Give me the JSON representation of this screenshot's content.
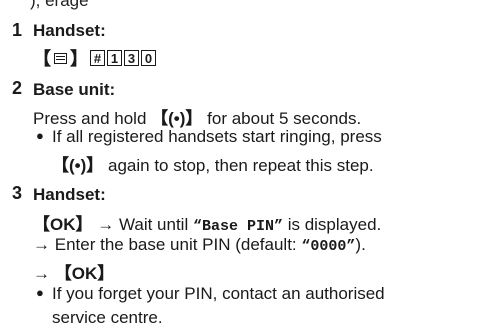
{
  "clip_text": "), erage",
  "steps": [
    {
      "number": "1",
      "heading": "Handset:",
      "keys": {
        "open_bracket": "【",
        "close_bracket": "】",
        "keypad": [
          "#",
          "1",
          "3",
          "0"
        ],
        "menu_icon": "menu-icon"
      }
    },
    {
      "number": "2",
      "heading": "Base unit:",
      "line1_before": "Press and hold ",
      "line1_key": "【(•)】",
      "line1_after": " for about 5 seconds.",
      "bullet": "●",
      "bullet_line1": "If all registered handsets start ringing, press",
      "bullet_line2_key": "【(•)】",
      "bullet_line2_after": " again to stop, then repeat this step."
    },
    {
      "number": "3",
      "heading": "Handset:",
      "line1_key": "【OK】",
      "line1_arrow": " → Wait until ",
      "line1_quote": "“Base PIN”",
      "line1_after": " is displayed.",
      "line2_arrow": "→ ",
      "line2_text": "Enter the base unit PIN (default: ",
      "line2_quote": "“0000”",
      "line2_end": ").",
      "line3_arrow": "→ ",
      "line3_key": "【OK】",
      "bullet": "●",
      "bullet_line1": "If you forget your PIN, contact an authorised",
      "bullet_line2": "service centre."
    }
  ]
}
